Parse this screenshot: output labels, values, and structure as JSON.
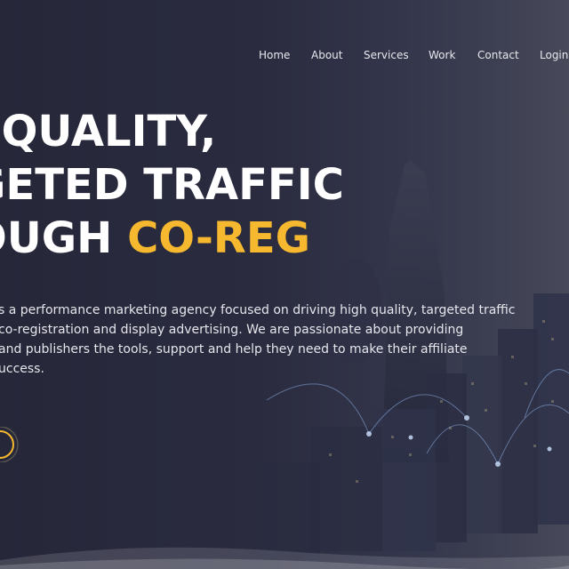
{
  "nav": {
    "items": [
      "Home",
      "About",
      "Services",
      "Work",
      "Contact",
      "Login"
    ]
  },
  "hero": {
    "headline_line1": "I QUALITY,",
    "headline_line2": "GETED TRAFFIC",
    "headline_line3_prefix": "OUGH ",
    "headline_line3_accent": "CO-REG",
    "description_lines": [
      "s a performance marketing agency focused on driving high quality, targeted traffic",
      "co-registration and display advertising. We are passionate about providing",
      "and publishers the tools, support and help they need to make their affiliate",
      "uccess."
    ]
  },
  "colors": {
    "background": "#2a2b3f",
    "accent": "#f5b82e",
    "text": "#ffffff"
  },
  "icons": {
    "cta": "play-circle-icon"
  }
}
